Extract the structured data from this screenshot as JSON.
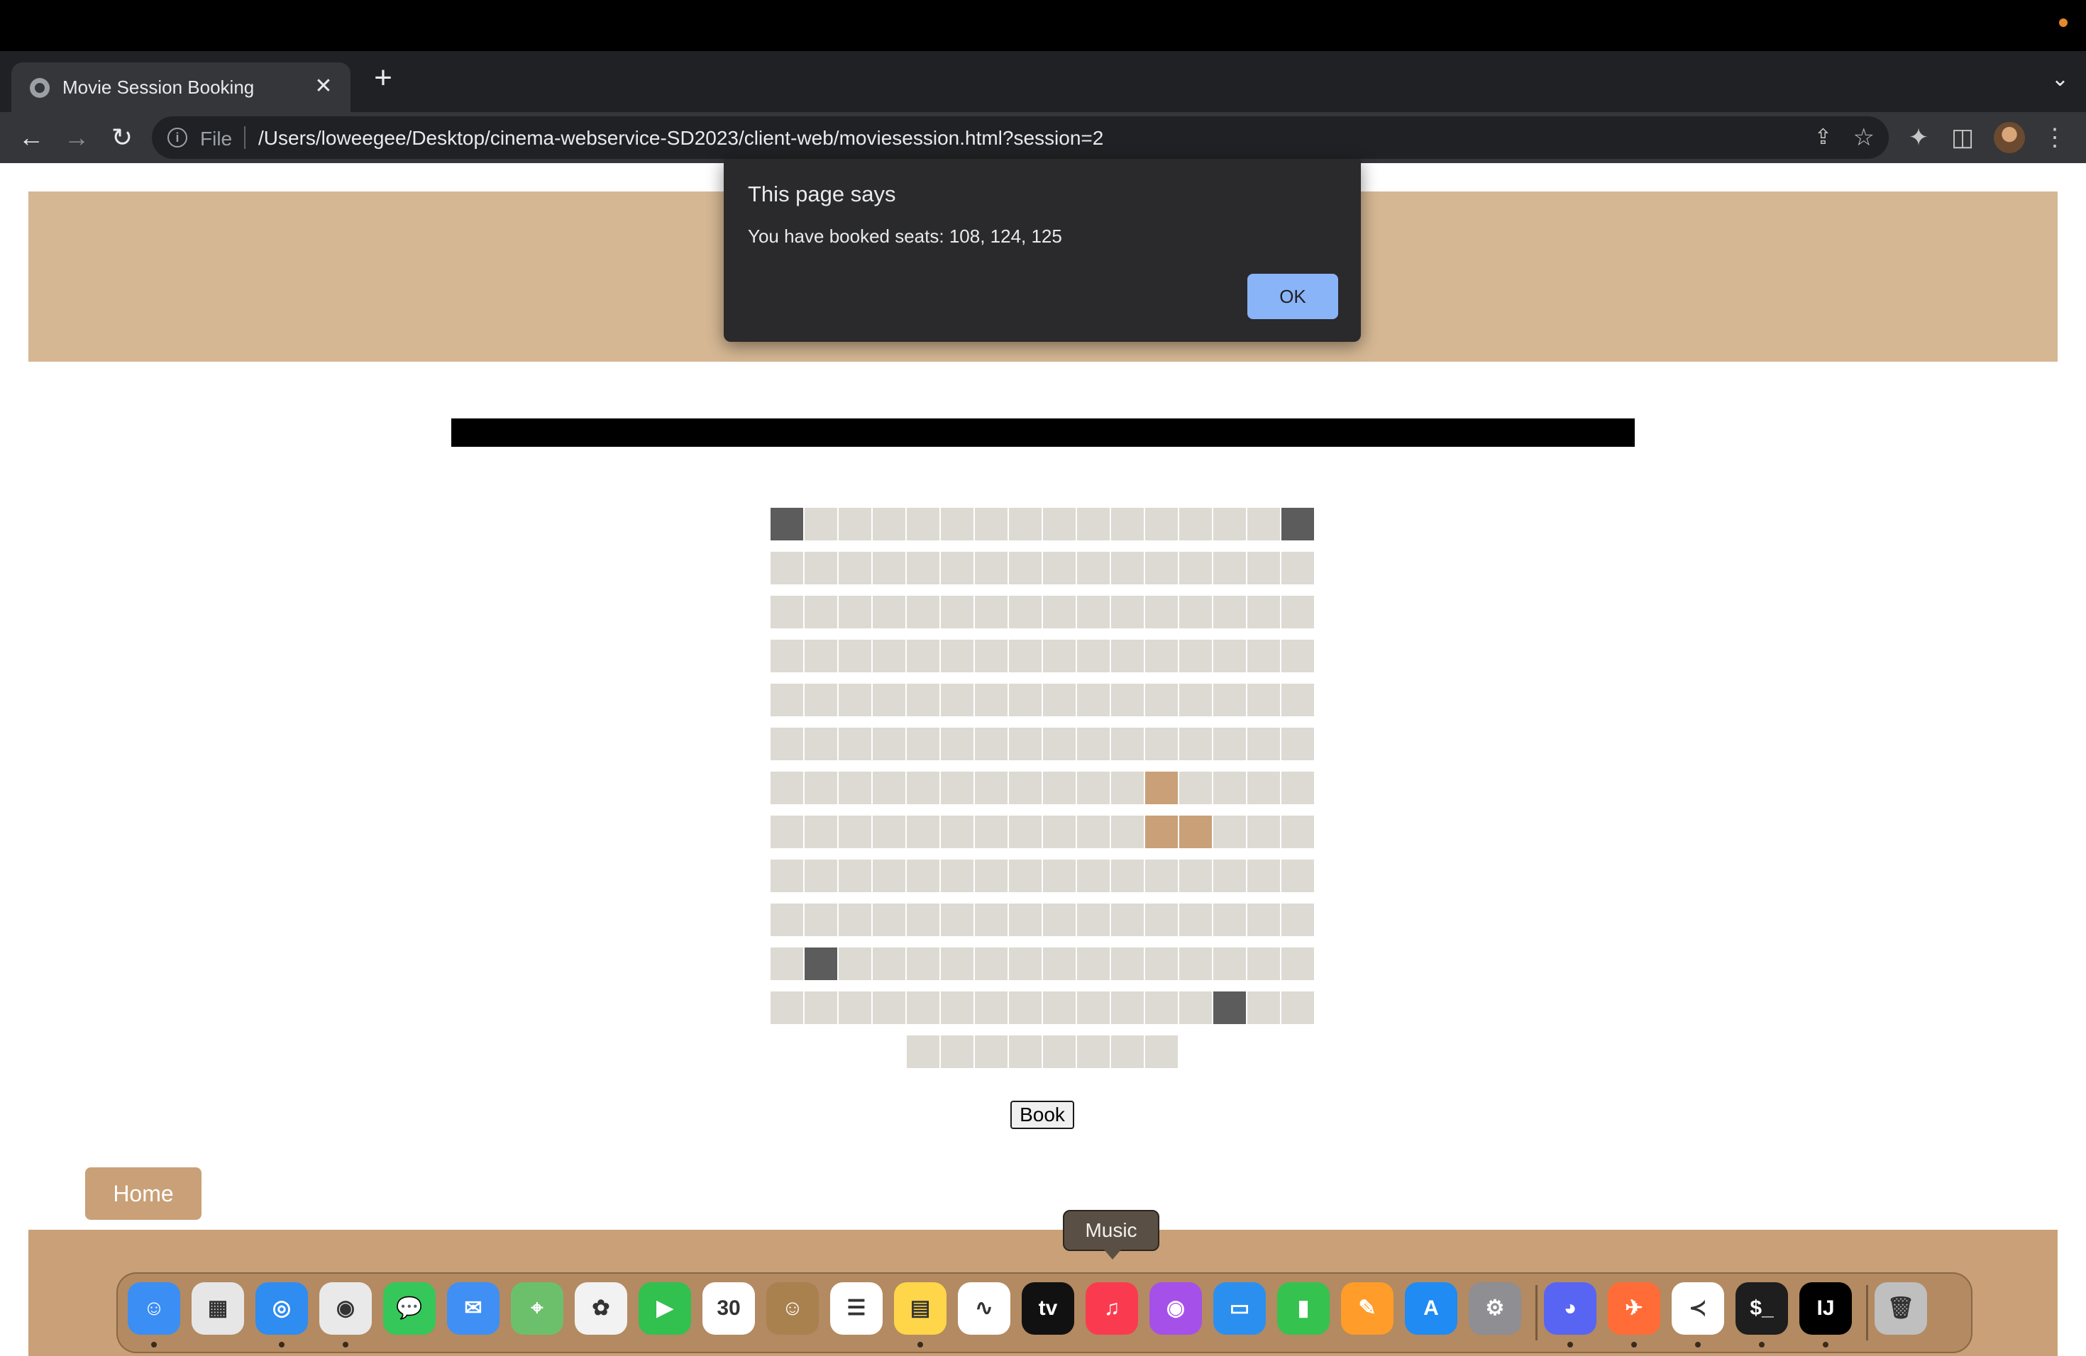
{
  "browser": {
    "tab_title": "Movie Session Booking",
    "tab_close": "✕",
    "new_tab": "+",
    "tab_menu": "⌄",
    "file_label": "File",
    "url": "/Users/loweegee/Desktop/cinema-webservice-SD2023/client-web/moviesession.html?session=2",
    "back": "←",
    "forward": "→",
    "reload": "↻",
    "share": "⇪",
    "star": "☆",
    "extensions": "✦",
    "sidepanel": "◫",
    "menu": "⋮"
  },
  "alert": {
    "title": "This page says",
    "message": "You have booked seats: 108, 124, 125",
    "ok_label": "OK"
  },
  "seating": {
    "columns": 16,
    "rows": 12,
    "last_row_seats": 8,
    "occupied": [
      [
        0,
        0
      ],
      [
        0,
        15
      ],
      [
        10,
        1
      ],
      [
        11,
        13
      ]
    ],
    "selected": [
      [
        6,
        11
      ],
      [
        7,
        11
      ],
      [
        7,
        12
      ]
    ],
    "colors": {
      "free": "#dcdad3",
      "occupied": "#5c5c5c",
      "selected": "#c9a077"
    }
  },
  "page": {
    "book_label": "Book",
    "home_label": "Home"
  },
  "dock": {
    "tooltip": "Music",
    "apps": [
      {
        "name": "finder-icon",
        "glyph": "☺",
        "color": "#3b8ef3",
        "running": true
      },
      {
        "name": "launchpad-icon",
        "glyph": "▦",
        "color": "#e6e6e6",
        "running": false
      },
      {
        "name": "safari-icon",
        "glyph": "◎",
        "color": "#2f8cf0",
        "running": true
      },
      {
        "name": "chrome-icon",
        "glyph": "◉",
        "color": "#e9e9e9",
        "running": true
      },
      {
        "name": "messages-icon",
        "glyph": "💬",
        "color": "#35c759",
        "running": false
      },
      {
        "name": "mail-icon",
        "glyph": "✉",
        "color": "#3f8ff5",
        "running": false
      },
      {
        "name": "maps-icon",
        "glyph": "⌖",
        "color": "#6dc06b",
        "running": false
      },
      {
        "name": "photos-icon",
        "glyph": "✿",
        "color": "#f2f2f2",
        "running": false
      },
      {
        "name": "facetime-icon",
        "glyph": "▶",
        "color": "#32c04f",
        "running": false
      },
      {
        "name": "calendar-icon",
        "glyph": "30",
        "color": "#ffffff",
        "running": false
      },
      {
        "name": "contacts-icon",
        "glyph": "☺",
        "color": "#a9814f",
        "running": false
      },
      {
        "name": "reminders-icon",
        "glyph": "☰",
        "color": "#ffffff",
        "running": false
      },
      {
        "name": "notes-icon",
        "glyph": "▤",
        "color": "#ffd54a",
        "running": true
      },
      {
        "name": "freeform-icon",
        "glyph": "∿",
        "color": "#ffffff",
        "running": false
      },
      {
        "name": "apple-tv-icon",
        "glyph": "tv",
        "color": "#111111",
        "running": false
      },
      {
        "name": "music-icon",
        "glyph": "♫",
        "color": "#fa3b4f",
        "running": false
      },
      {
        "name": "podcasts-icon",
        "glyph": "◉",
        "color": "#a550e8",
        "running": false
      },
      {
        "name": "keynote-icon",
        "glyph": "▭",
        "color": "#2b8ff0",
        "running": false
      },
      {
        "name": "numbers-icon",
        "glyph": "▮",
        "color": "#36c24f",
        "running": false
      },
      {
        "name": "pages-icon",
        "glyph": "✎",
        "color": "#ff9c2a",
        "running": false
      },
      {
        "name": "app-store-icon",
        "glyph": "A",
        "color": "#1f8bf3",
        "running": false
      },
      {
        "name": "system-settings-icon",
        "glyph": "⚙",
        "color": "#8e8e93",
        "running": false
      },
      {
        "name": "discord-icon",
        "glyph": "◕",
        "color": "#5865f2",
        "running": true
      },
      {
        "name": "postman-icon",
        "glyph": "✈",
        "color": "#ff6c37",
        "running": true
      },
      {
        "name": "vscode-icon",
        "glyph": "≺",
        "color": "#ffffff",
        "running": true
      },
      {
        "name": "terminal-icon",
        "glyph": "$_",
        "color": "#1e1e1e",
        "running": true
      },
      {
        "name": "intellij-icon",
        "glyph": "IJ",
        "color": "#000000",
        "running": true
      },
      {
        "name": "trash-icon",
        "glyph": "🗑",
        "color": "#bfbfbf",
        "running": false
      }
    ]
  }
}
